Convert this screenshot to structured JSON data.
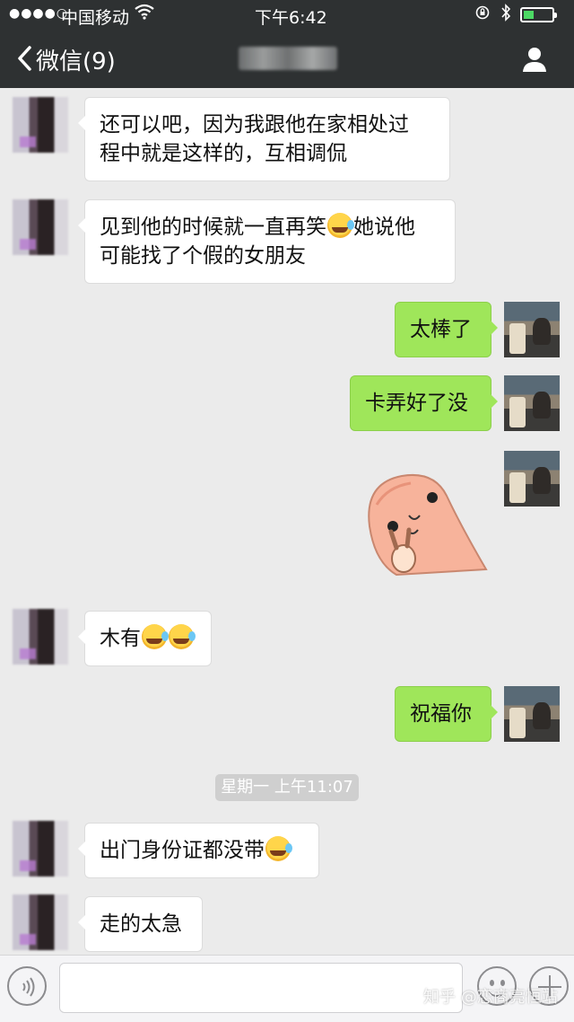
{
  "status_bar": {
    "signal": "●●●●○",
    "carrier": "中国移动",
    "wifi_icon": "wifi-icon",
    "time": "下午6:42",
    "lock_icon": "rotation-lock-icon",
    "bluetooth_icon": "bluetooth-icon",
    "battery_level": 0.35
  },
  "nav": {
    "back_label": "微信(9)",
    "title": "",
    "profile_icon": "person-icon"
  },
  "messages": [
    {
      "side": "in",
      "text": "还可以吧，因为我跟他在家相处过",
      "text2": "程中就是这样的，互相调侃"
    },
    {
      "side": "in",
      "text": "见到他的时候就一直再笑",
      "text_after_emoji": "她说他",
      "text2": "可能找了个假的女朋友"
    },
    {
      "side": "out",
      "text": "太棒了"
    },
    {
      "side": "out",
      "text": "卡弄好了没"
    },
    {
      "side": "out",
      "sticker": "victory-sticker"
    },
    {
      "side": "in",
      "text": "木有"
    },
    {
      "side": "out",
      "text": "祝福你"
    },
    {
      "side": "in",
      "text": "出门身份证都没带"
    },
    {
      "side": "in",
      "text": "走的太急"
    }
  ],
  "timestamp": "星期一 上午11:07",
  "input": {
    "placeholder": "",
    "voice_icon": "voice-icon",
    "emoji_icon": "smiley-icon",
    "plus_icon": "plus-icon"
  },
  "watermark": "知乎 @恋商亮恒站"
}
